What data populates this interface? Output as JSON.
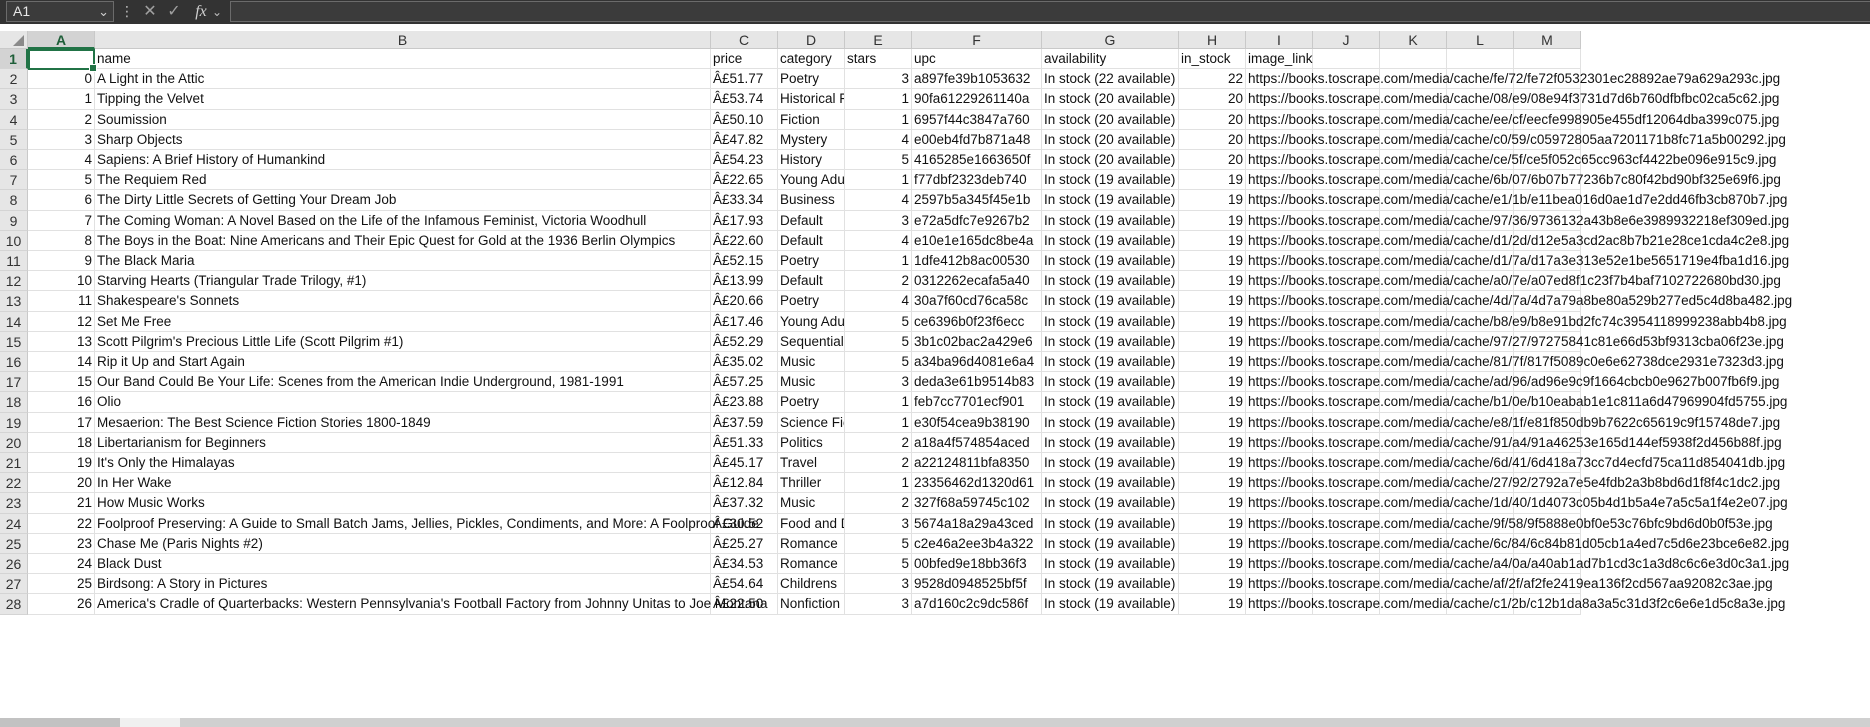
{
  "name_box": {
    "value": "A1",
    "chevron": "chevron-down-icon"
  },
  "formula_bar": {
    "cancel": "✕",
    "enter": "✓",
    "fx": "fx",
    "fx_chevron": "⌄",
    "value": ""
  },
  "columns": [
    "A",
    "B",
    "C",
    "D",
    "E",
    "F",
    "G",
    "H",
    "I",
    "J",
    "K",
    "L",
    "M"
  ],
  "rows": [
    [
      "",
      "name",
      "price",
      "category",
      "stars",
      "upc",
      "availability",
      "in_stock",
      "image_link"
    ],
    [
      "0",
      "A Light in the Attic",
      "Â£51.77",
      "Poetry",
      "3",
      "a897fe39b1053632",
      "In stock (22 available)",
      "22",
      "https://books.toscrape.com/media/cache/fe/72/fe72f0532301ec28892ae79a629a293c.jpg"
    ],
    [
      "1",
      "Tipping the Velvet",
      "Â£53.74",
      "Historical Fiction",
      "1",
      "90fa61229261140a",
      "In stock (20 available)",
      "20",
      "https://books.toscrape.com/media/cache/08/e9/08e94f3731d7d6b760dfbfbc02ca5c62.jpg"
    ],
    [
      "2",
      "Soumission",
      "Â£50.10",
      "Fiction",
      "1",
      "6957f44c3847a760",
      "In stock (20 available)",
      "20",
      "https://books.toscrape.com/media/cache/ee/cf/eecfe998905e455df12064dba399c075.jpg"
    ],
    [
      "3",
      "Sharp Objects",
      "Â£47.82",
      "Mystery",
      "4",
      "e00eb4fd7b871a48",
      "In stock (20 available)",
      "20",
      "https://books.toscrape.com/media/cache/c0/59/c05972805aa7201171b8fc71a5b00292.jpg"
    ],
    [
      "4",
      "Sapiens: A Brief History of Humankind",
      "Â£54.23",
      "History",
      "5",
      "4165285e1663650f",
      "In stock (20 available)",
      "20",
      "https://books.toscrape.com/media/cache/ce/5f/ce5f052c65cc963cf4422be096e915c9.jpg"
    ],
    [
      "5",
      "The Requiem Red",
      "Â£22.65",
      "Young Adult",
      "1",
      "f77dbf2323deb740",
      "In stock (19 available)",
      "19",
      "https://books.toscrape.com/media/cache/6b/07/6b07b77236b7c80f42bd90bf325e69f6.jpg"
    ],
    [
      "6",
      "The Dirty Little Secrets of Getting Your Dream Job",
      "Â£33.34",
      "Business",
      "4",
      "2597b5a345f45e1b",
      "In stock (19 available)",
      "19",
      "https://books.toscrape.com/media/cache/e1/1b/e11bea016d0ae1d7e2dd46fb3cb870b7.jpg"
    ],
    [
      "7",
      "The Coming Woman: A Novel Based on the Life of the Infamous Feminist, Victoria Woodhull",
      "Â£17.93",
      "Default",
      "3",
      "e72a5dfc7e9267b2",
      "In stock (19 available)",
      "19",
      "https://books.toscrape.com/media/cache/97/36/9736132a43b8e6e3989932218ef309ed.jpg"
    ],
    [
      "8",
      "The Boys in the Boat: Nine Americans and Their Epic Quest for Gold at the 1936 Berlin Olympics",
      "Â£22.60",
      "Default",
      "4",
      "e10e1e165dc8be4a",
      "In stock (19 available)",
      "19",
      "https://books.toscrape.com/media/cache/d1/2d/d12e5a3cd2ac8b7b21e28ce1cda4c2e8.jpg"
    ],
    [
      "9",
      "The Black Maria",
      "Â£52.15",
      "Poetry",
      "1",
      "1dfe412b8ac00530",
      "In stock (19 available)",
      "19",
      "https://books.toscrape.com/media/cache/d1/7a/d17a3e313e52e1be5651719e4fba1d16.jpg"
    ],
    [
      "10",
      "Starving Hearts (Triangular Trade Trilogy, #1)",
      "Â£13.99",
      "Default",
      "2",
      "0312262ecafa5a40",
      "In stock (19 available)",
      "19",
      "https://books.toscrape.com/media/cache/a0/7e/a07ed8f1c23f7b4baf7102722680bd30.jpg"
    ],
    [
      "11",
      "Shakespeare's Sonnets",
      "Â£20.66",
      "Poetry",
      "4",
      "30a7f60cd76ca58c",
      "In stock (19 available)",
      "19",
      "https://books.toscrape.com/media/cache/4d/7a/4d7a79a8be80a529b277ed5c4d8ba482.jpg"
    ],
    [
      "12",
      "Set Me Free",
      "Â£17.46",
      "Young Adult",
      "5",
      "ce6396b0f23f6ecc",
      "In stock (19 available)",
      "19",
      "https://books.toscrape.com/media/cache/b8/e9/b8e91bd2fc74c3954118999238abb4b8.jpg"
    ],
    [
      "13",
      "Scott Pilgrim's Precious Little Life (Scott Pilgrim #1)",
      "Â£52.29",
      "Sequential Art",
      "5",
      "3b1c02bac2a429e6",
      "In stock (19 available)",
      "19",
      "https://books.toscrape.com/media/cache/97/27/97275841c81e66d53bf9313cba06f23e.jpg"
    ],
    [
      "14",
      "Rip it Up and Start Again",
      "Â£35.02",
      "Music",
      "5",
      "a34ba96d4081e6a4",
      "In stock (19 available)",
      "19",
      "https://books.toscrape.com/media/cache/81/7f/817f5089c0e6e62738dce2931e7323d3.jpg"
    ],
    [
      "15",
      "Our Band Could Be Your Life: Scenes from the American Indie Underground, 1981-1991",
      "Â£57.25",
      "Music",
      "3",
      "deda3e61b9514b83",
      "In stock (19 available)",
      "19",
      "https://books.toscrape.com/media/cache/ad/96/ad96e9c9f1664cbcb0e9627b007fb6f9.jpg"
    ],
    [
      "16",
      "Olio",
      "Â£23.88",
      "Poetry",
      "1",
      "feb7cc7701ecf901",
      "In stock (19 available)",
      "19",
      "https://books.toscrape.com/media/cache/b1/0e/b10eabab1e1c811a6d47969904fd5755.jpg"
    ],
    [
      "17",
      "Mesaerion: The Best Science Fiction Stories 1800-1849",
      "Â£37.59",
      "Science Fiction",
      "1",
      "e30f54cea9b38190",
      "In stock (19 available)",
      "19",
      "https://books.toscrape.com/media/cache/e8/1f/e81f850db9b7622c65619c9f15748de7.jpg"
    ],
    [
      "18",
      "Libertarianism for Beginners",
      "Â£51.33",
      "Politics",
      "2",
      "a18a4f574854aced",
      "In stock (19 available)",
      "19",
      "https://books.toscrape.com/media/cache/91/a4/91a46253e165d144ef5938f2d456b88f.jpg"
    ],
    [
      "19",
      "It's Only the Himalayas",
      "Â£45.17",
      "Travel",
      "2",
      "a22124811bfa8350",
      "In stock (19 available)",
      "19",
      "https://books.toscrape.com/media/cache/6d/41/6d418a73cc7d4ecfd75ca11d854041db.jpg"
    ],
    [
      "20",
      "In Her Wake",
      "Â£12.84",
      "Thriller",
      "1",
      "23356462d1320d61",
      "In stock (19 available)",
      "19",
      "https://books.toscrape.com/media/cache/27/92/2792a7e5e4fdb2a3b8bd6d1f8f4c1dc2.jpg"
    ],
    [
      "21",
      "How Music Works",
      "Â£37.32",
      "Music",
      "2",
      "327f68a59745c102",
      "In stock (19 available)",
      "19",
      "https://books.toscrape.com/media/cache/1d/40/1d4073c05b4d1b5a4e7a5c5a1f4e2e07.jpg"
    ],
    [
      "22",
      "Foolproof Preserving: A Guide to Small Batch Jams, Jellies, Pickles, Condiments, and More: A Foolproof Guide",
      "Â£30.52",
      "Food and Drink",
      "3",
      "5674a18a29a43ced",
      "In stock (19 available)",
      "19",
      "https://books.toscrape.com/media/cache/9f/58/9f5888e0bf0e53c76bfc9bd6d0b0f53e.jpg"
    ],
    [
      "23",
      "Chase Me (Paris Nights #2)",
      "Â£25.27",
      "Romance",
      "5",
      "c2e46a2ee3b4a322",
      "In stock (19 available)",
      "19",
      "https://books.toscrape.com/media/cache/6c/84/6c84b81d05cb1a4ed7c5d6e23bce6e82.jpg"
    ],
    [
      "24",
      "Black Dust",
      "Â£34.53",
      "Romance",
      "5",
      "00bfed9e18bb36f3",
      "In stock (19 available)",
      "19",
      "https://books.toscrape.com/media/cache/a4/0a/a40ab1ad7b1cd3c1a3d8c6c6e3d0c3a1.jpg"
    ],
    [
      "25",
      "Birdsong: A Story in Pictures",
      "Â£54.64",
      "Childrens",
      "3",
      "9528d0948525bf5f",
      "In stock (19 available)",
      "19",
      "https://books.toscrape.com/media/cache/af/2f/af2fe2419ea136f2cd567aa92082c3ae.jpg"
    ],
    [
      "26",
      "America's Cradle of Quarterbacks: Western Pennsylvania's Football Factory from Johnny Unitas to Joe Montana",
      "Â£22.50",
      "Nonfiction",
      "3",
      "a7d160c2c9dc586f",
      "In stock (19 available)",
      "19",
      "https://books.toscrape.com/media/cache/c1/2b/c12b1da8a3a5c31d3f2c6e6e1d5c8a3e.jpg"
    ]
  ]
}
